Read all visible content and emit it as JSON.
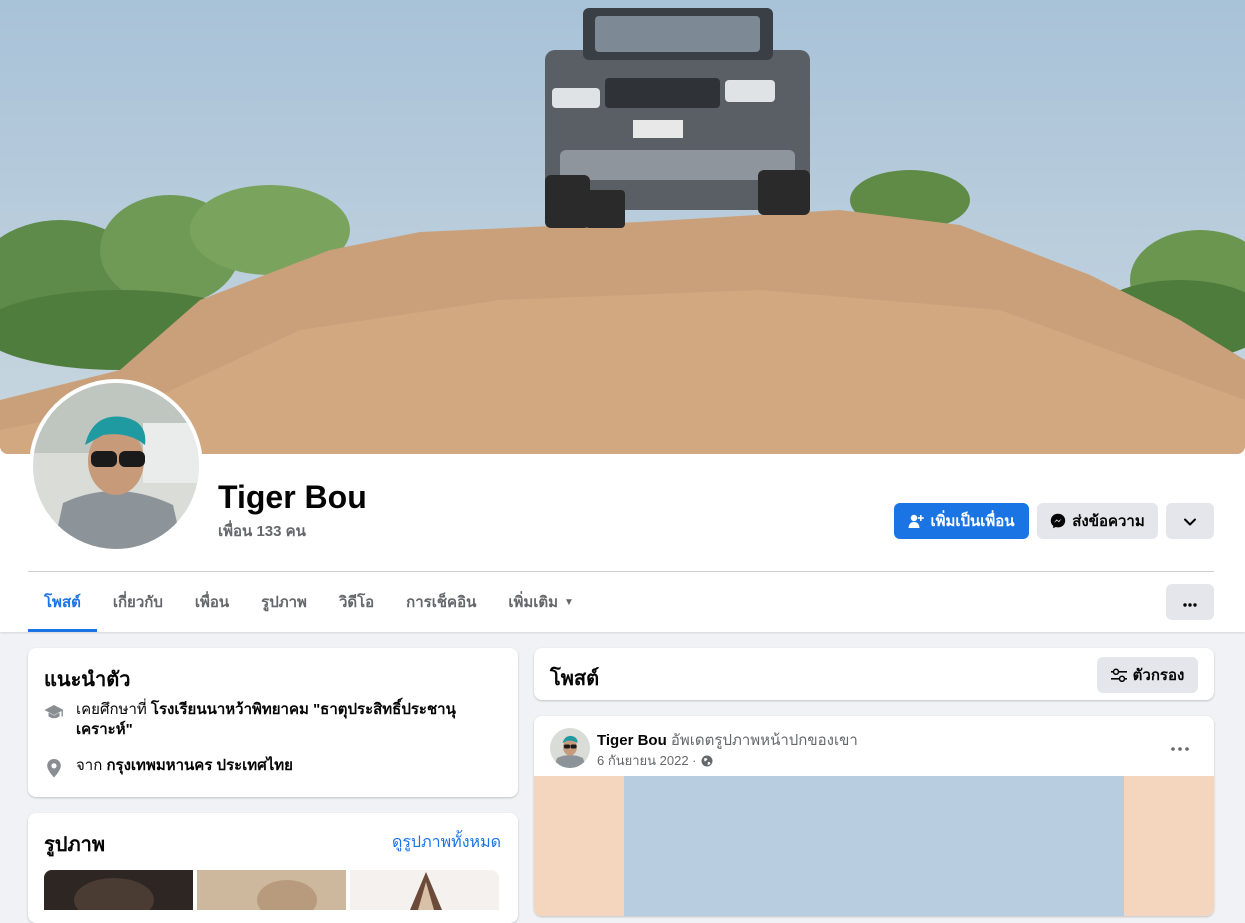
{
  "profile": {
    "name": "Tiger Bou",
    "friends": "เพื่อน 133 คน"
  },
  "actions": {
    "add_friend": "เพิ่มเป็นเพื่อน",
    "message": "ส่งข้อความ"
  },
  "tabs": [
    {
      "label": "โพสต์"
    },
    {
      "label": "เกี่ยวกับ"
    },
    {
      "label": "เพื่อน"
    },
    {
      "label": "รูปภาพ"
    },
    {
      "label": "วิดีโอ"
    },
    {
      "label": "การเช็คอิน"
    },
    {
      "label": "เพิ่มเติม"
    }
  ],
  "intro": {
    "title": "แนะนำตัว",
    "education_prefix": "เคยศึกษาที่ ",
    "education_school": "โรงเรียนนาหว้าพิทยาคม \"ธาตุประสิทธิ์ประชานุเคราะห์\"",
    "location_prefix": "จาก ",
    "location_place": "กรุงเทพมหานคร ประเทศไทย"
  },
  "photos": {
    "title": "รูปภาพ",
    "see_all": "ดูรูปภาพทั้งหมด"
  },
  "posts_header": {
    "title": "โพสต์",
    "filter": "ตัวกรอง"
  },
  "post": {
    "author": "Tiger Bou",
    "action": " อัพเดตรูปภาพหน้าปกของเขา",
    "date": "6 กันยายน 2022 ·"
  },
  "colors": {
    "accent": "#1b74e4",
    "secondary_button": "#e4e6eb",
    "background": "#f0f2f5"
  }
}
